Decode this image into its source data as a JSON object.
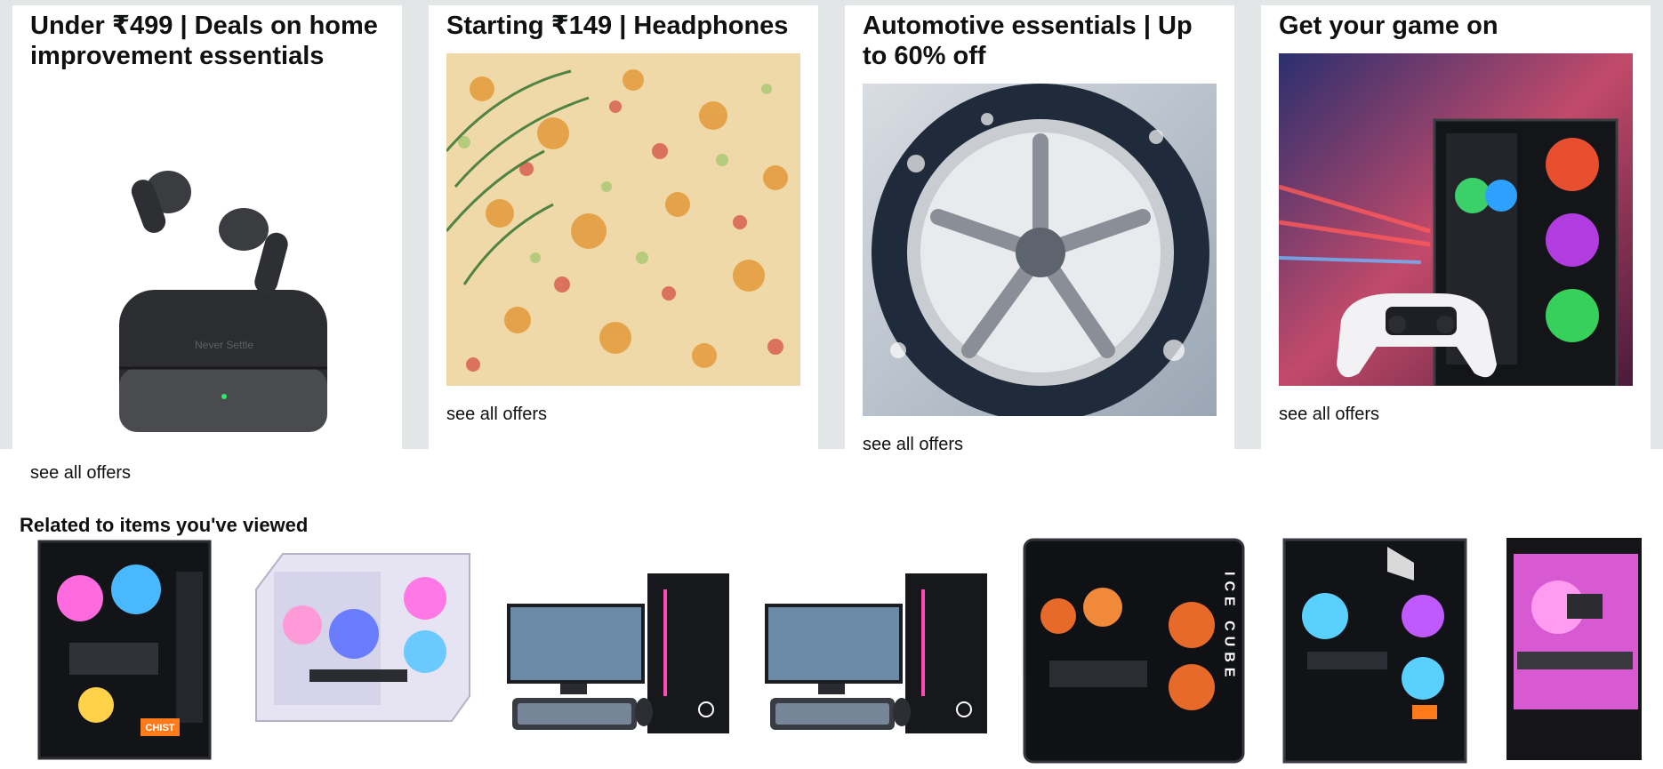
{
  "cards": [
    {
      "title": "Under ₹499 | Deals on home improvement essentials",
      "link": "see all offers",
      "image": "wireless-earbuds-with-charging-case"
    },
    {
      "title": "Starting ₹149 | Headphones",
      "link": "see all offers",
      "image": "floral-pattern-fabric"
    },
    {
      "title": "Automotive essentials | Up to 60% off",
      "link": "see all offers",
      "image": "car-wheel-being-washed"
    },
    {
      "title": "Get your game on",
      "link": "see all offers",
      "image": "gaming-pc-and-controller"
    }
  ],
  "earbuds_case_text": "Never Settle",
  "related": {
    "title": "Related to items you've viewed",
    "products": [
      {
        "image": "black-gaming-cabinet-rgb-fans",
        "badge": "CHIST"
      },
      {
        "image": "white-glass-cabinet-rgb-fans"
      },
      {
        "image": "desktop-pc-set-with-monitor-keyboard"
      },
      {
        "image": "desktop-pc-set-with-monitor-keyboard"
      },
      {
        "image": "ice-cube-black-cabinet",
        "side_text": "ICE CUBE"
      },
      {
        "image": "glass-cabinet-blue-fans"
      },
      {
        "image": "pink-lit-cabinet"
      }
    ]
  }
}
